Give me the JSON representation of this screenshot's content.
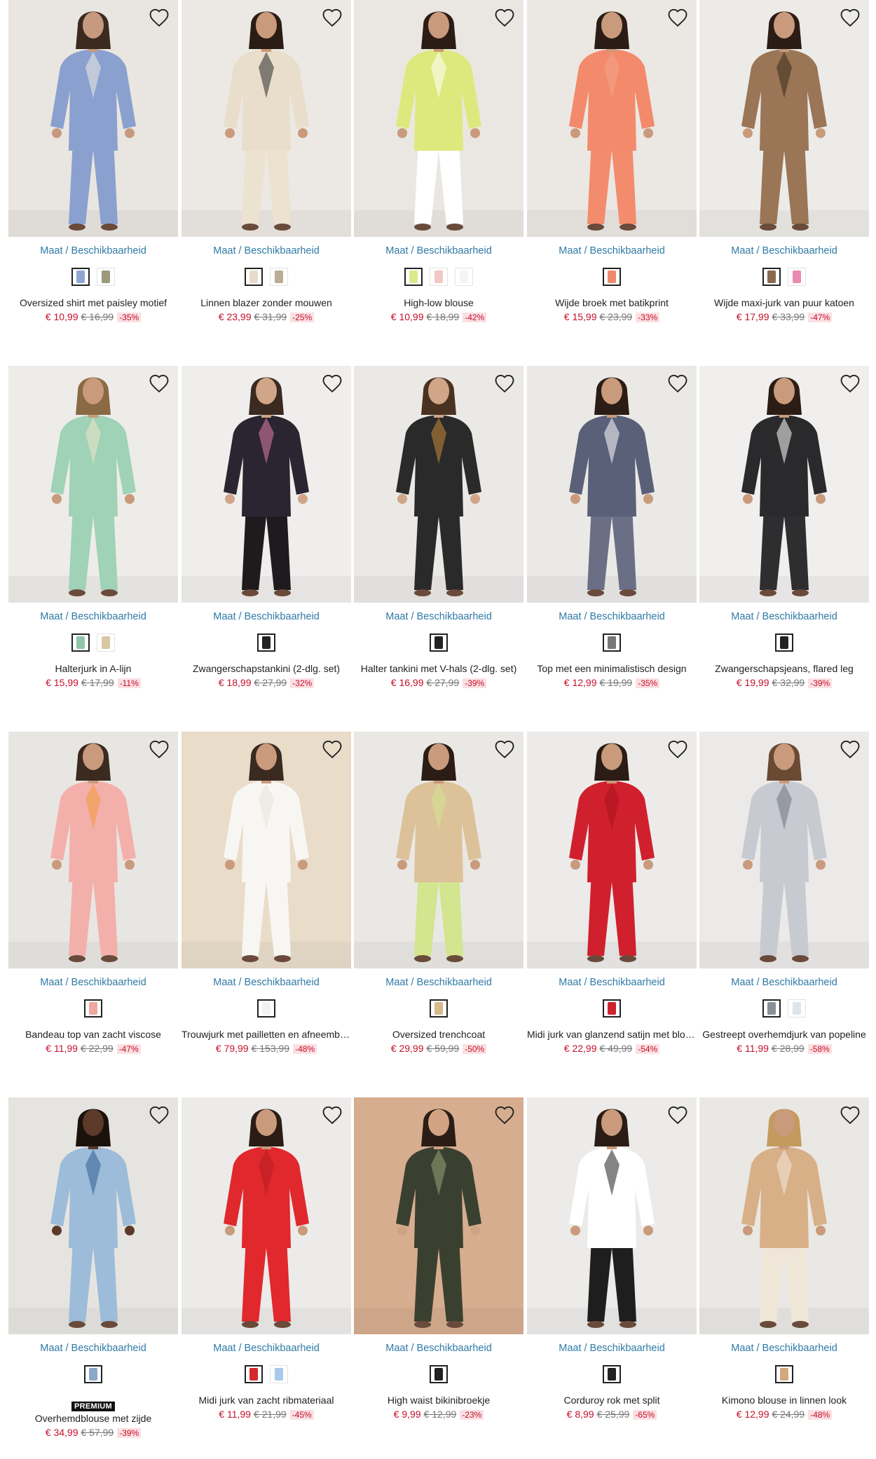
{
  "availability_label": "Maat / Beschikbaarheid",
  "products": [
    {
      "title": "Oversized shirt met paisley motief",
      "price": "€ 10,99",
      "old_price": "€ 16,99",
      "discount": "-35%",
      "swatches": [
        "#8fa6d3",
        "#9c9a7a"
      ],
      "bg": "#e9e5e0",
      "garment": "#8aa0cf",
      "accent": "#f1ece4",
      "skin": "#c79a80",
      "hair": "#3b2a20",
      "pants": "#8aa0cf"
    },
    {
      "title": "Linnen blazer zonder mouwen",
      "price": "€ 23,99",
      "old_price": "€ 31,99",
      "discount": "-25%",
      "swatches": [
        "#e6dccb",
        "#b9ad94"
      ],
      "bg": "#ece9e4",
      "garment": "#e8decb",
      "accent": "#2a2a2a",
      "skin": "#c99a7c",
      "hair": "#2b1d15",
      "pants": "#ece2d0"
    },
    {
      "title": "High-low blouse",
      "price": "€ 10,99",
      "old_price": "€ 18,99",
      "discount": "-42%",
      "swatches": [
        "#dbe98a",
        "#f2c8c4",
        "#f5f5f5"
      ],
      "bg": "#eae7e2",
      "garment": "#dde97d",
      "accent": "#ffffff",
      "skin": "#c99a7c",
      "hair": "#2b1d15",
      "pants": "#ffffff"
    },
    {
      "title": "Wijde broek met batikprint",
      "price": "€ 15,99",
      "old_price": "€ 23,99",
      "discount": "-33%",
      "swatches": [
        "#f08a6c"
      ],
      "bg": "#ebe7e2",
      "garment": "#f28a6b",
      "accent": "#f6a48a",
      "skin": "#c99a7c",
      "hair": "#2b1d15",
      "pants": "#f38b6d"
    },
    {
      "title": "Wijde maxi-jurk van puur katoen",
      "price": "€ 17,99",
      "old_price": "€ 33,99",
      "discount": "-47%",
      "swatches": [
        "#8a6a4e",
        "#ea8bb3"
      ],
      "bg": "#ecebe8",
      "garment": "#9a7556",
      "accent": "#3b2a1c",
      "skin": "#c99a7c",
      "hair": "#2b1d15",
      "pants": "#9a7556"
    },
    {
      "title": "Halterjurk in A-lijn",
      "price": "€ 15,99",
      "old_price": "€ 17,99",
      "discount": "-11%",
      "swatches": [
        "#8fc7a9",
        "#d8c9a4"
      ],
      "bg": "#eeece9",
      "garment": "#9fd2b6",
      "accent": "#efe4c8",
      "skin": "#c99a7c",
      "hair": "#8a6a44",
      "pants": "#9fd2b6"
    },
    {
      "title": "Zwangerschapstankini (2-dlg. set)",
      "price": "€ 18,99",
      "old_price": "€ 27,99",
      "discount": "-32%",
      "swatches": [
        "#222222"
      ],
      "bg": "#efeeec",
      "garment": "#2a2530",
      "accent": "#e27fa8",
      "skin": "#d1a588",
      "hair": "#3a2a20",
      "pants": "#1f1a1e"
    },
    {
      "title": "Halter tankini met V-hals (2-dlg. set)",
      "price": "€ 16,99",
      "old_price": "€ 27,99",
      "discount": "-39%",
      "swatches": [
        "#222222"
      ],
      "bg": "#ebe9e6",
      "garment": "#2a2a2a",
      "accent": "#c98a3a",
      "skin": "#d1a588",
      "hair": "#4a3222",
      "pants": "#2a2a2a"
    },
    {
      "title": "Top met een minimalistisch design",
      "price": "€ 12,99",
      "old_price": "€ 19,99",
      "discount": "-35%",
      "swatches": [
        "#777777"
      ],
      "bg": "#ebe9e6",
      "garment": "#5a6078",
      "accent": "#ffffff",
      "skin": "#c99a7c",
      "hair": "#2b1d15",
      "pants": "#6a6f86"
    },
    {
      "title": "Zwangerschapsjeans, flared leg",
      "price": "€ 19,99",
      "old_price": "€ 32,99",
      "discount": "-39%",
      "swatches": [
        "#222222"
      ],
      "bg": "#f0efee",
      "garment": "#2a2a2c",
      "accent": "#ffffff",
      "skin": "#c99a7c",
      "hair": "#2b1d15",
      "pants": "#2e2e31"
    },
    {
      "title": "Bandeau top van zacht viscose",
      "price": "€ 11,99",
      "old_price": "€ 22,99",
      "discount": "-47%",
      "swatches": [
        "#f0a7a0"
      ],
      "bg": "#e8e6e3",
      "garment": "#f3b0ab",
      "accent": "#f39b3a",
      "skin": "#c99a7c",
      "hair": "#3a2a20",
      "pants": "#f3b0ab"
    },
    {
      "title": "Trouwjurk met pailletten en afneembaar",
      "price": "€ 79,99",
      "old_price": "€ 153,99",
      "discount": "-48%",
      "swatches": [
        "#f3f3f3"
      ],
      "bg": "#e9dcc9",
      "garment": "#f7f6f2",
      "accent": "#e7e3da",
      "skin": "#c99a7c",
      "hair": "#3a2a20",
      "pants": "#f7f6f2"
    },
    {
      "title": "Oversized trenchcoat",
      "price": "€ 29,99",
      "old_price": "€ 59,99",
      "discount": "-50%",
      "swatches": [
        "#d7b98a"
      ],
      "bg": "#eae8e4",
      "garment": "#dcc199",
      "accent": "#d3e58e",
      "skin": "#c99a7c",
      "hair": "#2b1d15",
      "pants": "#d3e58e"
    },
    {
      "title": "Midi jurk van glanzend satijn met blote rug",
      "price": "€ 22,99",
      "old_price": "€ 49,99",
      "discount": "-54%",
      "swatches": [
        "#d0232e"
      ],
      "bg": "#ecebe9",
      "garment": "#d0202d",
      "accent": "#a8131e",
      "skin": "#c99a7c",
      "hair": "#2b1d15",
      "pants": "#d0202d"
    },
    {
      "title": "Gestreept overhemdjurk van popeline",
      "price": "€ 11,99",
      "old_price": "€ 28,99",
      "discount": "-58%",
      "swatches": [
        "#8a8f99",
        "#dfe3ea"
      ],
      "bg": "#ebeae8",
      "garment": "#c7cad0",
      "accent": "#6d7380",
      "skin": "#c99a7c",
      "hair": "#6a4a32",
      "pants": "#c7cad0"
    },
    {
      "title": "Overhemdblouse met zijde",
      "price": "€ 34,99",
      "old_price": "€ 57,99",
      "discount": "-39%",
      "premium": "PREMIUM",
      "swatches": [
        "#8aa7c9"
      ],
      "bg": "#e6e4e0",
      "garment": "#9cbcd9",
      "accent": "#2f5d93",
      "skin": "#5b3a2a",
      "hair": "#1c120c",
      "pants": "#9cbcd9"
    },
    {
      "title": "Midi jurk van zacht ribmateriaal",
      "price": "€ 11,99",
      "old_price": "€ 21,99",
      "discount": "-45%",
      "swatches": [
        "#d42a2a",
        "#a7c9ea"
      ],
      "bg": "#ecebe9",
      "garment": "#e0282d",
      "accent": "#b51d22",
      "skin": "#c99a7c",
      "hair": "#2b1d15",
      "pants": "#e0282d"
    },
    {
      "title": "High waist bikinibroekje",
      "price": "€ 9,99",
      "old_price": "€ 12,99",
      "discount": "-23%",
      "swatches": [
        "#222222"
      ],
      "bg": "#d6ad8f",
      "garment": "#3a4030",
      "accent": "#9aa078",
      "skin": "#d2a383",
      "hair": "#2b1d15",
      "pants": "#3a4030"
    },
    {
      "title": "Corduroy rok met split",
      "price": "€ 8,99",
      "old_price": "€ 25,99",
      "discount": "-65%",
      "swatches": [
        "#222222"
      ],
      "bg": "#ecebe9",
      "garment": "#ffffff",
      "accent": "#1f1f1f",
      "skin": "#c99a7c",
      "hair": "#2b1d15",
      "pants": "#1e1e1e"
    },
    {
      "title": "Kimono blouse in linnen look",
      "price": "€ 12,99",
      "old_price": "€ 24,99",
      "discount": "-48%",
      "swatches": [
        "#d4a77c"
      ],
      "bg": "#eae8e4",
      "garment": "#d8b088",
      "accent": "#f4eadd",
      "skin": "#c99a7c",
      "hair": "#c59a5e",
      "pants": "#efe6d8"
    }
  ]
}
